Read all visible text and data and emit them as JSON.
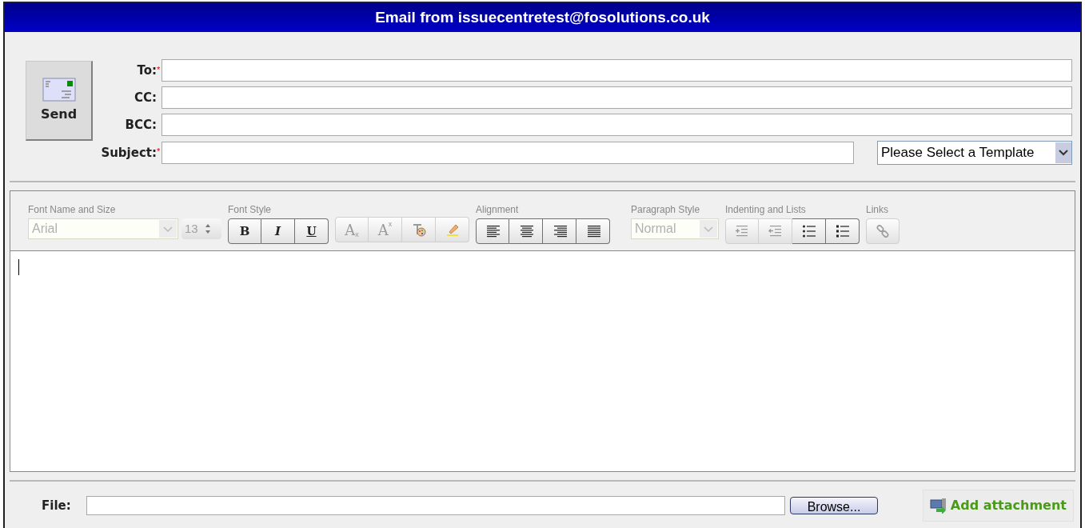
{
  "window": {
    "title": "Email from issuecentretest@fosolutions.co.uk"
  },
  "send_button": {
    "label": "Send"
  },
  "fields": [
    {
      "label": "To:",
      "required_mark": "*"
    },
    {
      "label": "CC:"
    },
    {
      "label": "BCC:"
    },
    {
      "label": "Subject:",
      "required_mark": "*",
      "template_select": {
        "value": "Please Select a Template"
      }
    }
  ],
  "toolbar": [
    {
      "title": "Font Name and Size",
      "controls": [
        {
          "kind": "font_select",
          "value": "Arial",
          "disabled": true
        },
        {
          "kind": "size_spinner",
          "value": "13",
          "disabled": true
        }
      ]
    },
    {
      "title": "Font Style",
      "controls": [
        {
          "kind": "bold",
          "label": "B",
          "disabled": false
        },
        {
          "kind": "italic",
          "label": "I",
          "disabled": false
        },
        {
          "kind": "underline",
          "label": "U",
          "disabled": false
        }
      ]
    },
    {
      "controls": [
        {
          "kind": "subscript",
          "label": "A",
          "index": "x",
          "disabled": true
        },
        {
          "kind": "superscript",
          "label": "A",
          "index": "x",
          "disabled": true
        },
        {
          "kind": "text_color",
          "disabled": true
        },
        {
          "kind": "highlight",
          "disabled": true
        }
      ]
    },
    {
      "title": "Alignment",
      "controls": [
        {
          "kind": "align_left",
          "disabled": false
        },
        {
          "kind": "align_center",
          "disabled": false
        },
        {
          "kind": "align_right",
          "disabled": false
        },
        {
          "kind": "justify",
          "disabled": false
        }
      ]
    },
    {
      "title": "Paragraph Style",
      "controls": [
        {
          "kind": "para_select",
          "value": "Normal",
          "disabled": true
        }
      ]
    },
    {
      "title": "Indenting and Lists",
      "controls": [
        {
          "kind": "indent",
          "disabled": true
        },
        {
          "kind": "outdent",
          "disabled": true
        },
        {
          "kind": "bullets",
          "disabled": false
        },
        {
          "kind": "numbering",
          "disabled": false
        }
      ]
    },
    {
      "title": "Links",
      "controls": [
        {
          "kind": "link",
          "disabled": true
        }
      ]
    }
  ],
  "file": {
    "label": "File:",
    "browse": "Browse..."
  },
  "add_attachment": {
    "label": "Add attachment"
  }
}
